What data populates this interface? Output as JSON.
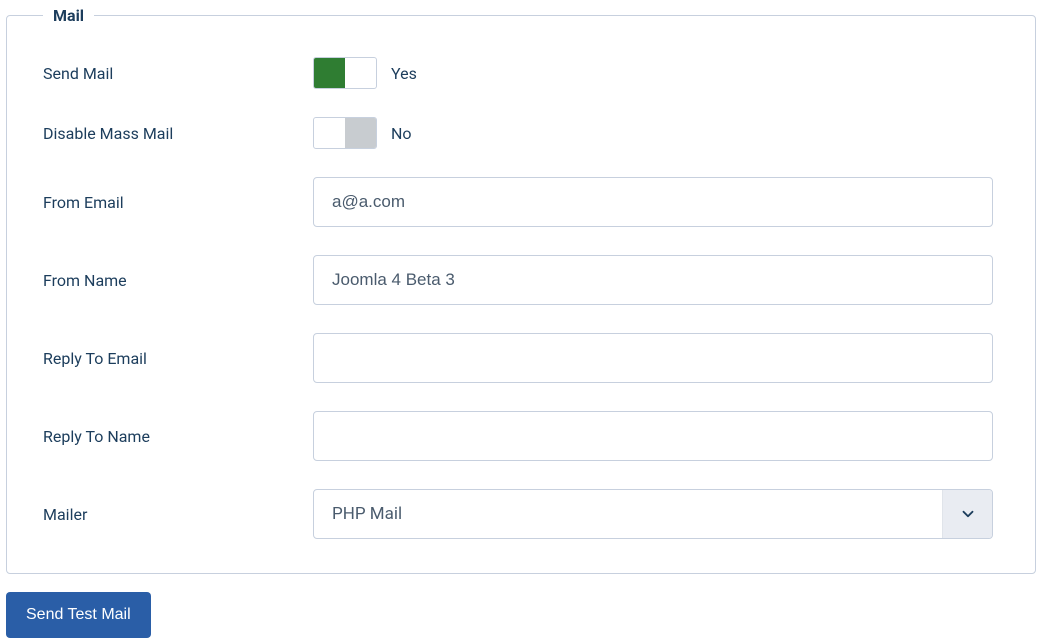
{
  "fieldset": {
    "legend": "Mail"
  },
  "labels": {
    "sendMail": "Send Mail",
    "disableMassMail": "Disable Mass Mail",
    "fromEmail": "From Email",
    "fromName": "From Name",
    "replyToEmail": "Reply To Email",
    "replyToName": "Reply To Name",
    "mailer": "Mailer"
  },
  "toggles": {
    "sendMail": {
      "state": "on",
      "text": "Yes"
    },
    "disableMassMail": {
      "state": "off",
      "text": "No"
    }
  },
  "inputs": {
    "fromEmail": "a@a.com",
    "fromName": "Joomla 4 Beta 3",
    "replyToEmail": "",
    "replyToName": ""
  },
  "select": {
    "mailer": "PHP Mail"
  },
  "buttons": {
    "sendTest": "Send Test Mail"
  }
}
